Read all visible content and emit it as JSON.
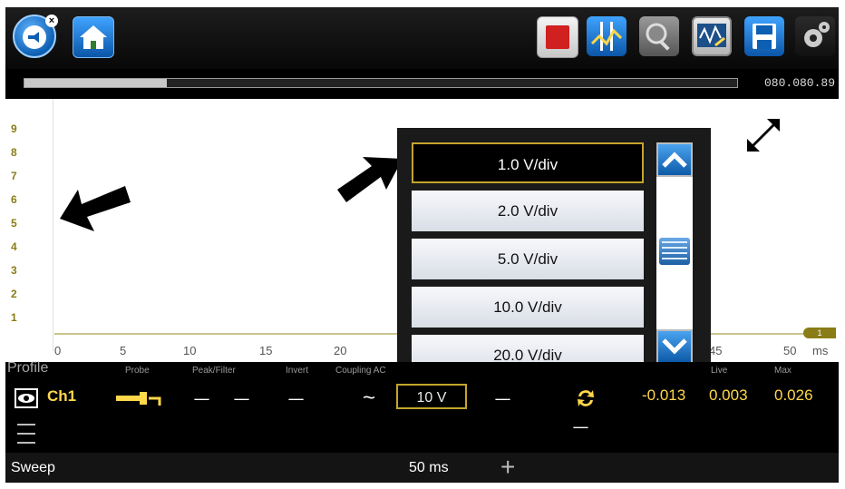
{
  "toolbar": {
    "icons": [
      "back-arrow-icon",
      "close-x-icon",
      "home-icon",
      "stop-icon",
      "cursor-icon",
      "zoom-icon",
      "trace-icon",
      "save-icon",
      "gear-icon"
    ]
  },
  "sweep": {
    "counter": "080.080.89",
    "progress": 0.2
  },
  "graph": {
    "y_ticks": [
      "9",
      "8",
      "7",
      "6",
      "5",
      "4",
      "3",
      "2",
      "1"
    ],
    "x_ticks": [
      "0",
      "5",
      "10",
      "15",
      "20",
      "45",
      "50"
    ],
    "x_unit": "ms",
    "channel_marker": "1",
    "trace_color": "#c9c48a"
  },
  "dropdown": {
    "options": [
      "1.0 V/div",
      "2.0 V/div",
      "5.0 V/div",
      "10.0 V/div",
      "20.0 V/div"
    ],
    "selected": "1.0 V/div"
  },
  "channel_panel": {
    "headers": {
      "profile": "Profile",
      "probe": "Probe",
      "peak_filter": "Peak/Filter",
      "invert": "Invert",
      "coupling": "Coupling AC",
      "live": "Live",
      "max": "Max"
    },
    "ch1": {
      "label": "Ch1",
      "dash": "------",
      "coupling_symbol": "~",
      "scale": "10 V",
      "min_value": "-0.013",
      "live_value": "0.003",
      "max_value": "0.026"
    },
    "sweep_label": "Sweep",
    "sweep_value": "50 ms",
    "plus": "+"
  },
  "colors": {
    "accent_gold": "#c3a52b",
    "value_yellow": "#ffd74a",
    "toolbar_blue": "#0d5fb3"
  }
}
